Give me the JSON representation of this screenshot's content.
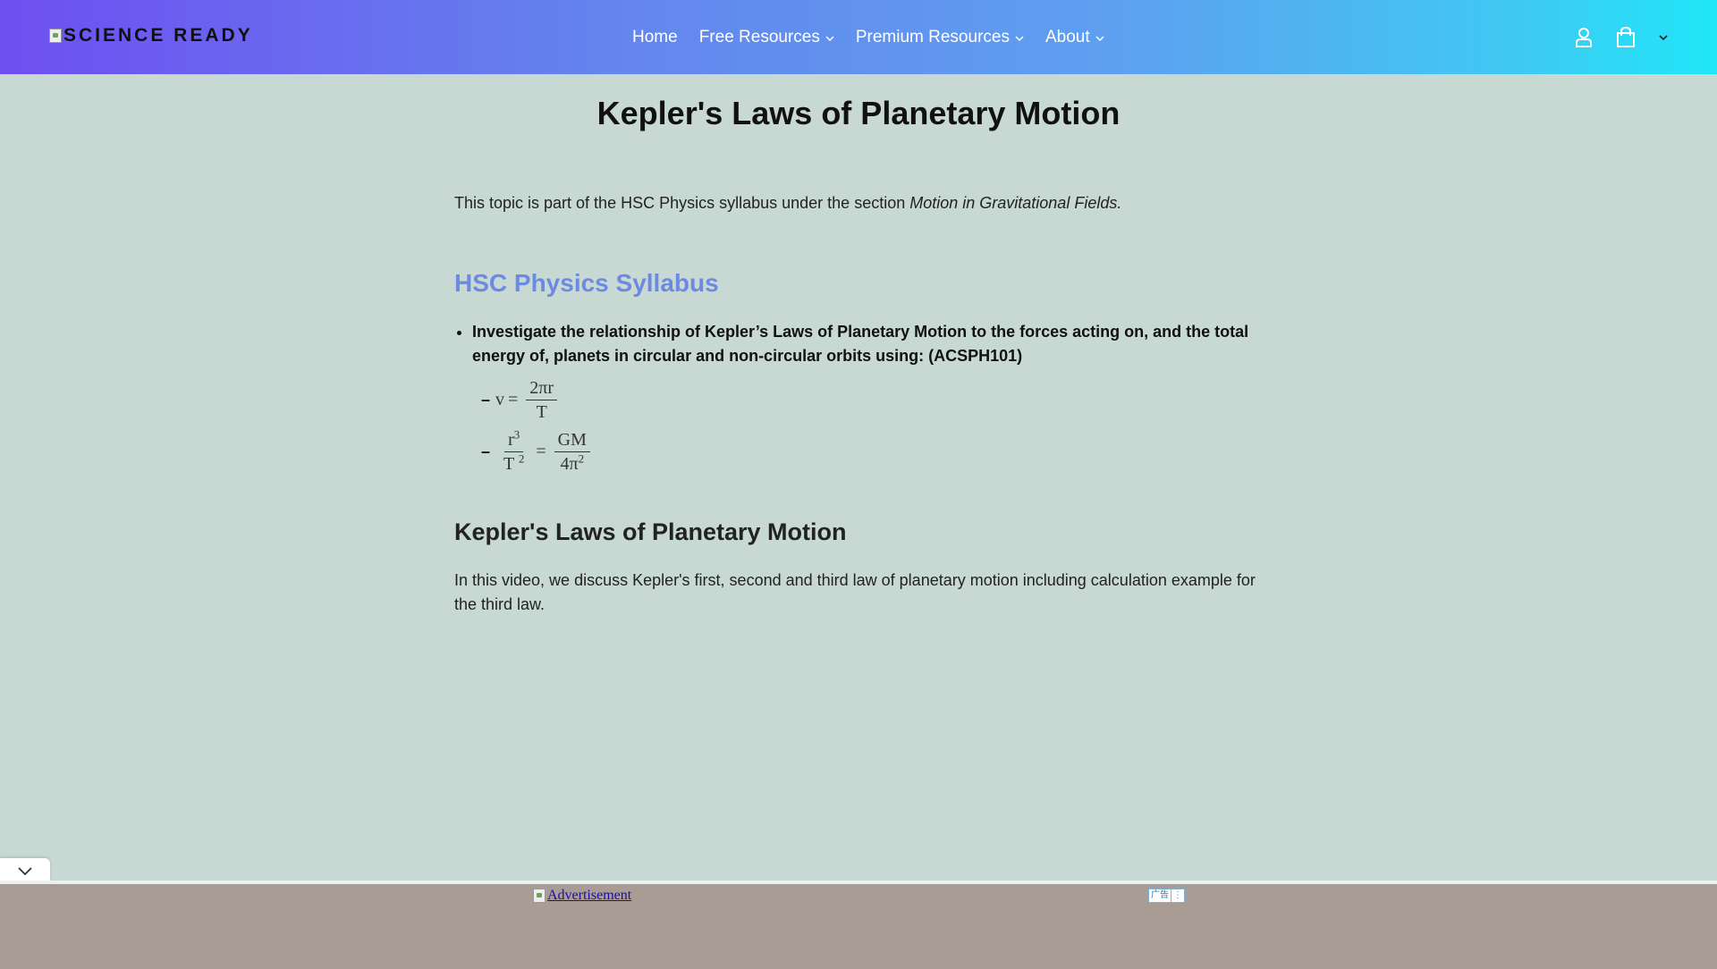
{
  "header": {
    "logo_text": "SCIENCE READY",
    "nav": [
      {
        "label": "Home",
        "dropdown": false
      },
      {
        "label": "Free Resources",
        "dropdown": true
      },
      {
        "label": "Premium Resources",
        "dropdown": true
      },
      {
        "label": "About",
        "dropdown": true
      }
    ],
    "icons": [
      "account-icon",
      "cart-icon",
      "chevron-down-icon"
    ]
  },
  "page": {
    "title": "Kepler's Laws of Planetary Motion",
    "intro_prefix": "This topic is part of the HSC Physics syllabus under the section ",
    "intro_section": "Motion in Gravitational Fields."
  },
  "syllabus": {
    "heading": "HSC Physics Syllabus",
    "outcome": "Investigate the relationship of Kepler’s Laws of Planetary Motion to the forces acting on, and the total energy of, planets in circular and non-circular orbits using: (ACSPH101)",
    "formula1": {
      "lhs": "v",
      "num": "2πr",
      "den": "T"
    },
    "formula2": {
      "num_base": "r",
      "num_exp": "3",
      "den_base": "T",
      "den_exp": "2",
      "rhs_num": "GM",
      "rhs_den_base": "4π",
      "rhs_den_exp": "2"
    }
  },
  "video_section": {
    "heading": "Kepler's Laws of Planetary Motion",
    "text": "In this video, we discuss Kepler's first, second and third law of planetary motion including calculation example for the third law."
  },
  "ad": {
    "link_text": "Advertisement",
    "badge_label": "广告",
    "badge_menu": "⋮"
  },
  "colors": {
    "background": "#c8d9d3",
    "syllabus_heading": "#6c8ae4",
    "ad_bar": "#a89c94"
  }
}
